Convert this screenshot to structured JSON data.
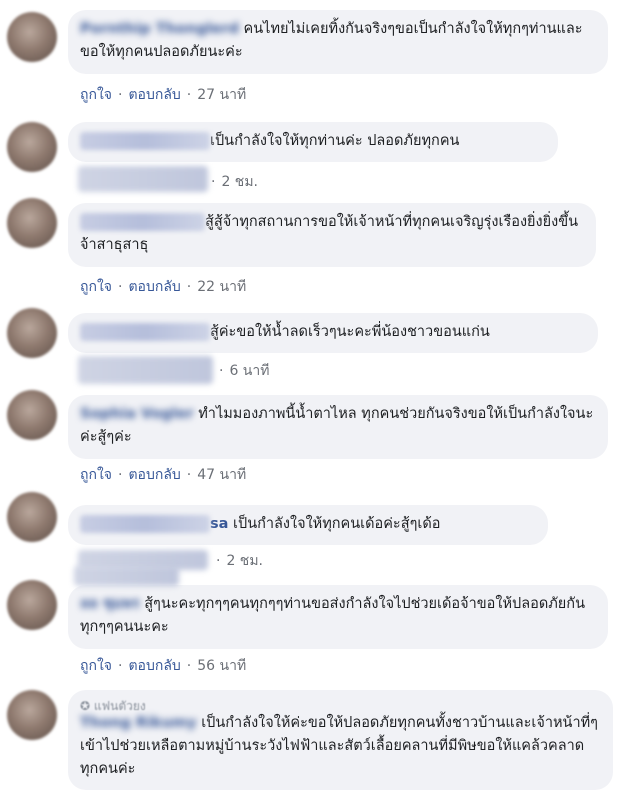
{
  "actions": {
    "like": "ถูกใจ",
    "reply": "ตอบกลับ",
    "separator": "·"
  },
  "comments": [
    {
      "name": "Pornthip Thonglerd",
      "text": "คนไทยไม่เคยทิ้งกันจริงๆขอเป็นกำลังใจให้ทุกๆท่านและขอให้ทุกคนปลอดภัยนะค่ะ",
      "time": "27 นาที"
    },
    {
      "name": "",
      "text": "เป็นกำลังใจให้ทุกท่านค่ะ ปลอดภัยทุกคน",
      "time": "2 ชม."
    },
    {
      "name": "",
      "text": "สู้สู้จ้าทุกสถานการขอให้เจ้าหน้าที่ทุกคนเจริญรุ่งเรืองยิ่งยิ่งขึ้นจ้าสาธุสาธุ",
      "time": "22 นาที"
    },
    {
      "name": "",
      "text": "สู้ค่ะขอให้น้ำลดเร็วๆนะคะพี่น้องชาวขอนแก่น",
      "time": "6 นาที"
    },
    {
      "name": "Sophia Vogler",
      "text": "ทำไมมองภาพนี้น้ำตาไหล ทุกคนช่วยกันจริงขอให้เป็นกำลังใจนะค่ะสู้ๆค่ะ",
      "time": "47 นาที"
    },
    {
      "name": "sa",
      "text": "เป็นกำลังใจให้ทุกคนเด้อค่ะสู้ๆเด้อ",
      "time": "2 ชม."
    },
    {
      "name": "ลล ชุมพร",
      "text": "สู้ๆนะคะทุกๆๆคนทุกๆๆท่านขอส่งกำลังใจไปช่วยเด้อจ้าขอให้ปลอดภัยกันทุกๆๆคนนะคะ",
      "time": "56 นาที"
    },
    {
      "badge": "แฟนตัวยง",
      "name": "Thong Rikumy",
      "text": "เป็นกำลังใจให้ค่ะขอให้ปลอดภัยทุกคนทั้งชาวบ้านและเจ้าหน้าที่ๆเข้าไปช่วยเหลือตามหมู่บ้านระวังไฟฟ้าและสัตว์เลื้อยคลานที่มีพิษขอให้แคล้วคลาดทุกคนค่ะ"
    }
  ]
}
